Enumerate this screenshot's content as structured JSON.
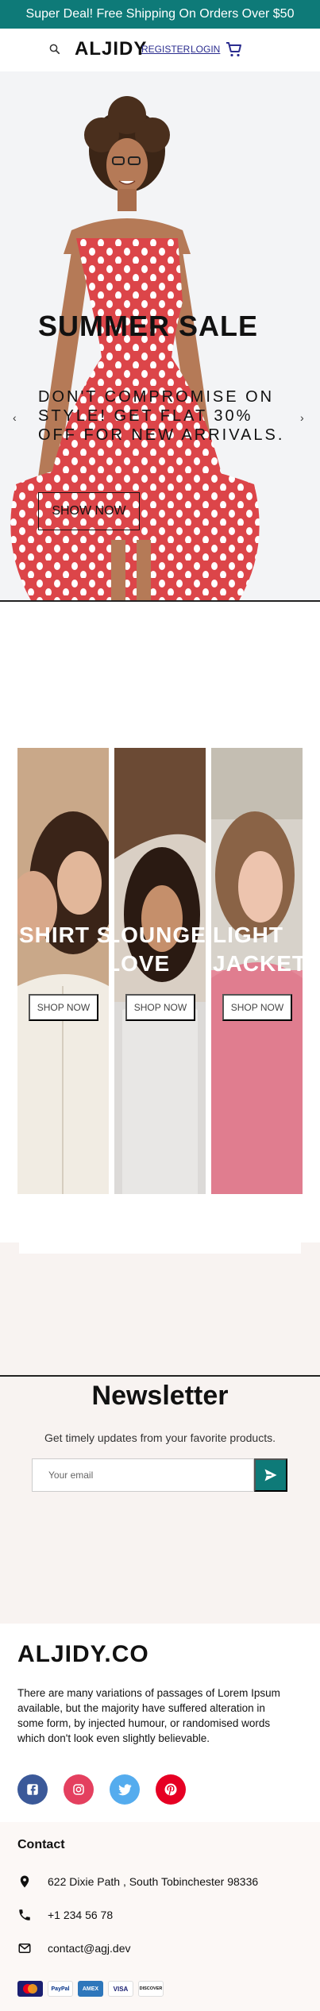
{
  "announcement": "Super Deal! Free Shipping On Orders Over $50",
  "nav": {
    "logo": "ALJIDY",
    "register": "REGISTER",
    "login": "LOGIN"
  },
  "hero": {
    "title": "SUMMER SALE",
    "subtitle": "DON'T COMPROMISE ON STYLE! GET FLAT 30% OFF FOR NEW ARRIVALS.",
    "button": "SHOW NOW",
    "prev": "‹",
    "next": "›"
  },
  "categories": [
    {
      "title": "SHIRT STYLE",
      "button": "SHOP NOW"
    },
    {
      "title": "LOUNGEWEAR LOVE",
      "button": "SHOP NOW"
    },
    {
      "title": "LIGHT JACKETS",
      "button": "SHOP NOW"
    }
  ],
  "newsletter": {
    "title": "Newsletter",
    "subtitle": "Get timely updates from your favorite products.",
    "placeholder": "Your email"
  },
  "footer": {
    "brand": "ALJIDY.CO",
    "description": "There are many variations of passages of Lorem Ipsum available, but the majority have suffered alteration in some form, by injected humour, or randomised words which don't look even slightly believable.",
    "contact_title": "Contact",
    "address": "622 Dixie Path , South Tobinchester 98336",
    "phone": "+1 234 56 78",
    "email": "contact@agj.dev",
    "payments": [
      "MasterCard",
      "PayPal",
      "AMEX",
      "VISA",
      "DISCOVER"
    ]
  },
  "colors": {
    "accent": "#0e7a78",
    "facebook": "#3b5999",
    "instagram": "#e4405f",
    "twitter": "#55acee",
    "pinterest": "#e60023"
  },
  "icons": [
    "search-icon",
    "cart-icon",
    "send-icon",
    "facebook-icon",
    "instagram-icon",
    "twitter-icon",
    "pinterest-icon",
    "location-icon",
    "phone-icon",
    "mail-icon"
  ]
}
